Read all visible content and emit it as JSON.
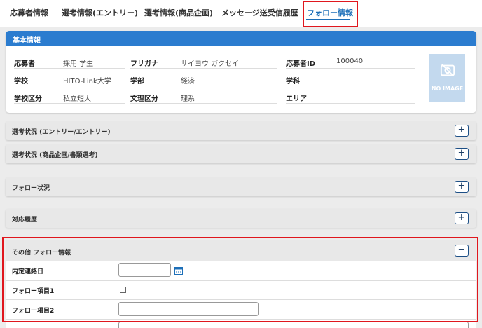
{
  "tabs": [
    {
      "label": "応募者情報"
    },
    {
      "label": "選考情報(エントリー)"
    },
    {
      "label": "選考情報(商品企画)"
    },
    {
      "label": "メッセージ送受信履歴"
    },
    {
      "label": "フォロー情報"
    }
  ],
  "basic_info": {
    "title": "基本情報",
    "fields": {
      "applicant_label": "応募者",
      "applicant_value": "採用 学生",
      "furigana_label": "フリガナ",
      "furigana_value": "サイヨウ ガクセイ",
      "id_label": "応募者ID",
      "id_value": "100040",
      "school_label": "学校",
      "school_value": "HITO-Link大学",
      "faculty_label": "学部",
      "faculty_value": "経済",
      "department_label": "学科",
      "department_value": "",
      "school_type_label": "学校区分",
      "school_type_value": "私立短大",
      "track_label": "文理区分",
      "track_value": "理系",
      "area_label": "エリア",
      "area_value": ""
    },
    "no_image": "NO IMAGE"
  },
  "accordions": [
    {
      "title": "選考状況 (エントリー/エントリー)",
      "btn": "+"
    },
    {
      "title": "選考状況 (商品企画/書類選考)",
      "btn": "+"
    },
    {
      "title": "フォロー状況",
      "btn": "+"
    },
    {
      "title": "対応履歴",
      "btn": "+"
    }
  ],
  "other_follow": {
    "title": "その他 フォロー情報",
    "btn": "−",
    "rows": [
      {
        "label": "内定連絡日"
      },
      {
        "label": "フォロー項目1"
      },
      {
        "label": "フォロー項目2"
      }
    ]
  },
  "colors": {
    "accent": "#2b7ccf",
    "highlight": "#e0171e"
  }
}
